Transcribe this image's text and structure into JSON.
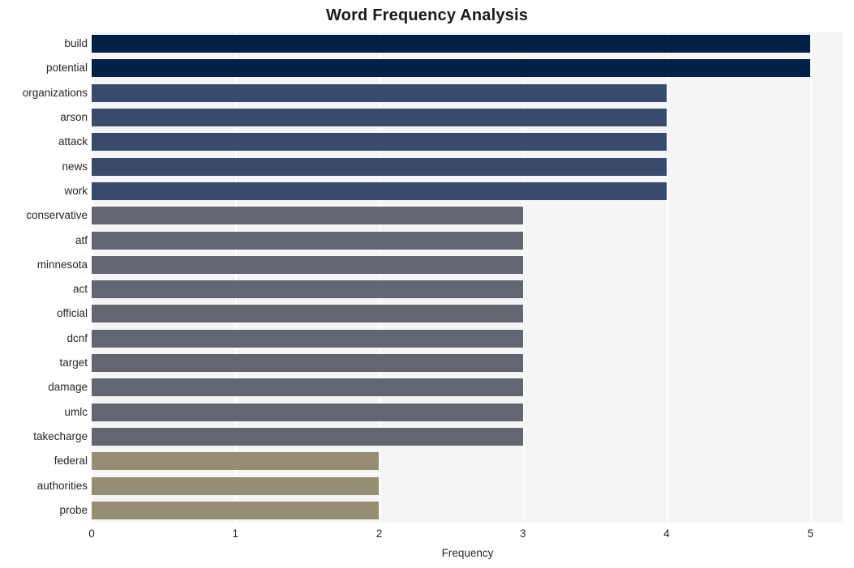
{
  "chart_data": {
    "type": "bar",
    "orientation": "horizontal",
    "title": "Word Frequency Analysis",
    "xlabel": "Frequency",
    "ylabel": "",
    "categories": [
      "build",
      "potential",
      "organizations",
      "arson",
      "attack",
      "news",
      "work",
      "conservative",
      "atf",
      "minnesota",
      "act",
      "official",
      "dcnf",
      "target",
      "damage",
      "umlc",
      "takecharge",
      "federal",
      "authorities",
      "probe"
    ],
    "values": [
      5,
      5,
      4,
      4,
      4,
      4,
      4,
      3,
      3,
      3,
      3,
      3,
      3,
      3,
      3,
      3,
      3,
      2,
      2,
      2
    ],
    "bar_colors": [
      "#002147",
      "#002147",
      "#384a6e",
      "#384a6e",
      "#384a6e",
      "#384a6e",
      "#384a6e",
      "#636670",
      "#636670",
      "#636670",
      "#636670",
      "#636670",
      "#636670",
      "#636670",
      "#636670",
      "#636670",
      "#636670",
      "#958d74",
      "#958d74",
      "#958d74"
    ],
    "xticks": [
      0,
      1,
      2,
      3,
      4,
      5
    ],
    "xtick_labels": [
      "0",
      "1",
      "2",
      "3",
      "4",
      "5"
    ],
    "xlim": [
      0,
      5.23
    ],
    "grid": "vertical",
    "grid_color": "#ffffff",
    "plot_background": "#f5f5f5",
    "figure_background": "#ffffff",
    "legend": "none"
  }
}
